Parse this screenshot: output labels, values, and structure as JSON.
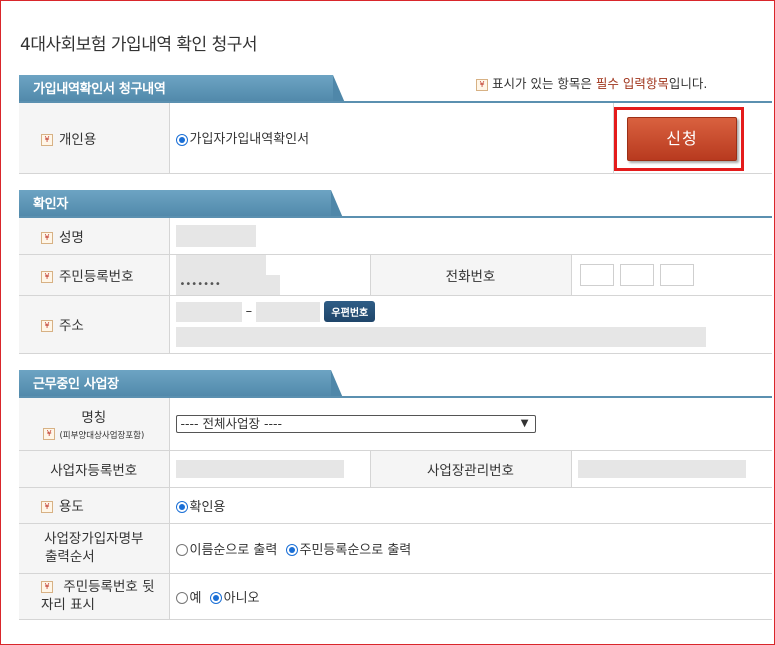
{
  "page": {
    "title": "4대사회보험 가입내역 확인 청구서"
  },
  "legend": {
    "pre": "표시가 있는 항목은 ",
    "required": "필수 입력항목",
    "post": "입니다."
  },
  "request_section": {
    "tab_label": "가입내역확인서 청구내역",
    "row_label": "개인용",
    "option_label": "가입자가입내역확인서",
    "apply_label": "신청"
  },
  "confirmer_section": {
    "tab_label": "확인자",
    "name_label": "성명",
    "rrn_label": "주민등록번호",
    "rrn_masked": "•••••••",
    "phone_label": "전화번호",
    "address_label": "주소",
    "zip_dash": "–",
    "zip_button": "우편번호"
  },
  "workplace_section": {
    "tab_label": "근무중인 사업장",
    "name_label": "명칭",
    "name_sub_label": "(피부양대상사업장포함)",
    "workplace_select_value": "---- 전체사업장 ----",
    "biz_reg_label": "사업자등록번호",
    "site_mgmt_label": "사업장관리번호",
    "purpose_label": "용도",
    "purpose_option": "확인용",
    "order_label_1": "사업장가입자명부",
    "order_label_2": "출력순서",
    "order_opt_name": "이름순으로 출력",
    "order_opt_rrn": "주민등록순으로 출력",
    "rrn_tail_label_1": "주민등록번호 뒷",
    "rrn_tail_label_2": "자리 표시",
    "rrn_tail_yes": "예",
    "rrn_tail_no": "아니오"
  },
  "icons": {
    "required": "required-mark-icon",
    "radio_selected": "radio-selected-icon",
    "radio_unselected": "radio-unselected-icon",
    "dropdown": "chevron-down-icon"
  },
  "colors": {
    "tab": "#5b90b0",
    "apply_button": "#c84a2b",
    "highlight_border": "#e41b1b",
    "required_text": "#a0351c"
  }
}
